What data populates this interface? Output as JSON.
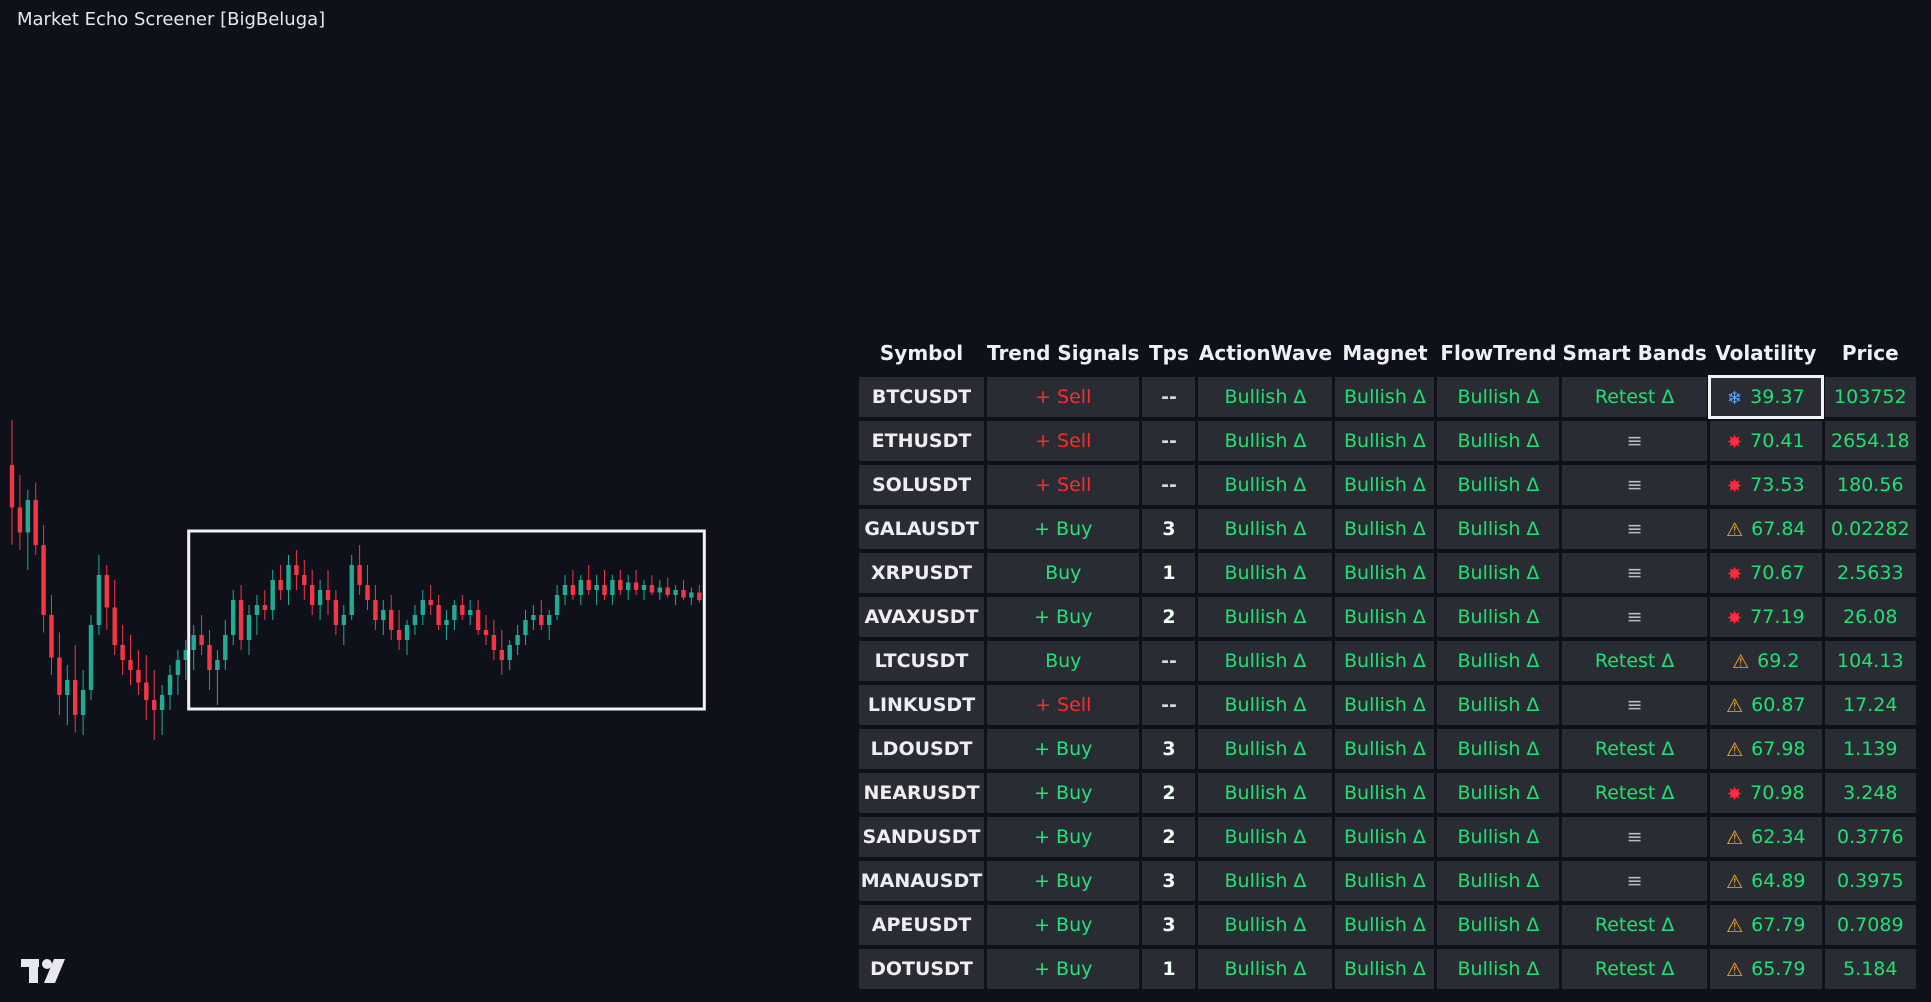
{
  "window": {
    "title": "Market Echo Screener [BigBeluga]"
  },
  "colors": {
    "background": "#0f111a",
    "bull": "#22ab94",
    "bear": "#f23645",
    "sell_cell_bg": "#8b2433",
    "buy_cell_bg": "#2a4a42",
    "tps_cell_bg": "#1f7a57",
    "text_green": "#22e070",
    "text_red": "#ff2a2a",
    "selection_box": "#f2f2f2"
  },
  "table": {
    "headers": [
      "Symbol",
      "Trend Signals",
      "Tps",
      "ActionWave",
      "Magnet",
      "FlowTrend",
      "Smart Bands",
      "Volatility",
      "Price"
    ],
    "rows": [
      {
        "symbol": "BTCUSDT",
        "trend": "+ Sell",
        "trend_type": "sell",
        "tps": "--",
        "action": "Bullish Δ",
        "magnet": "Bullish Δ",
        "flow": "Bullish Δ",
        "smart": "Retest Δ",
        "vol_icon": "snowflake-icon",
        "vol_glyph": "❄",
        "volatility": "39.37",
        "price": "103752",
        "selected": true
      },
      {
        "symbol": "ETHUSDT",
        "trend": "+ Sell",
        "trend_type": "sell",
        "tps": "--",
        "action": "Bullish Δ",
        "magnet": "Bullish Δ",
        "flow": "Bullish Δ",
        "smart": "≡",
        "vol_icon": "burst-icon",
        "vol_glyph": "✸",
        "volatility": "70.41",
        "price": "2654.18"
      },
      {
        "symbol": "SOLUSDT",
        "trend": "+ Sell",
        "trend_type": "sell",
        "tps": "--",
        "action": "Bullish Δ",
        "magnet": "Bullish Δ",
        "flow": "Bullish Δ",
        "smart": "≡",
        "vol_icon": "burst-icon",
        "vol_glyph": "✸",
        "volatility": "73.53",
        "price": "180.56"
      },
      {
        "symbol": "GALAUSDT",
        "trend": "+ Buy",
        "trend_type": "buy",
        "tps": "3",
        "action": "Bullish Δ",
        "magnet": "Bullish Δ",
        "flow": "Bullish Δ",
        "smart": "≡",
        "vol_icon": "warning-icon",
        "vol_glyph": "⚠",
        "volatility": "67.84",
        "price": "0.02282"
      },
      {
        "symbol": "XRPUSDT",
        "trend": "Buy",
        "trend_type": "buy",
        "tps": "1",
        "action": "Bullish Δ",
        "magnet": "Bullish Δ",
        "flow": "Bullish Δ",
        "smart": "≡",
        "vol_icon": "burst-icon",
        "vol_glyph": "✸",
        "volatility": "70.67",
        "price": "2.5633"
      },
      {
        "symbol": "AVAXUSDT",
        "trend": "+ Buy",
        "trend_type": "buy",
        "tps": "2",
        "action": "Bullish Δ",
        "magnet": "Bullish Δ",
        "flow": "Bullish Δ",
        "smart": "≡",
        "vol_icon": "burst-icon",
        "vol_glyph": "✸",
        "volatility": "77.19",
        "price": "26.08"
      },
      {
        "symbol": "LTCUSDT",
        "trend": "Buy",
        "trend_type": "buy-strong",
        "tps": "--",
        "action": "Bullish Δ",
        "magnet": "Bullish Δ",
        "flow": "Bullish Δ",
        "smart": "Retest Δ",
        "vol_icon": "warning-icon",
        "vol_glyph": "⚠",
        "volatility": "69.2",
        "price": "104.13"
      },
      {
        "symbol": "LINKUSDT",
        "trend": "+ Sell",
        "trend_type": "sell",
        "tps": "--",
        "action": "Bullish Δ",
        "magnet": "Bullish Δ",
        "flow": "Bullish Δ",
        "smart": "≡",
        "vol_icon": "warning-icon",
        "vol_glyph": "⚠",
        "volatility": "60.87",
        "price": "17.24"
      },
      {
        "symbol": "LDOUSDT",
        "trend": "+ Buy",
        "trend_type": "buy",
        "tps": "3",
        "action": "Bullish Δ",
        "magnet": "Bullish Δ",
        "flow": "Bullish Δ",
        "smart": "Retest Δ",
        "vol_icon": "warning-icon",
        "vol_glyph": "⚠",
        "volatility": "67.98",
        "price": "1.139"
      },
      {
        "symbol": "NEARUSDT",
        "trend": "+ Buy",
        "trend_type": "buy",
        "tps": "2",
        "action": "Bullish Δ",
        "magnet": "Bullish Δ",
        "flow": "Bullish Δ",
        "smart": "Retest Δ",
        "vol_icon": "burst-icon",
        "vol_glyph": "✸",
        "volatility": "70.98",
        "price": "3.248"
      },
      {
        "symbol": "SANDUSDT",
        "trend": "+ Buy",
        "trend_type": "buy",
        "tps": "2",
        "action": "Bullish Δ",
        "magnet": "Bullish Δ",
        "flow": "Bullish Δ",
        "smart": "≡",
        "vol_icon": "warning-icon",
        "vol_glyph": "⚠",
        "volatility": "62.34",
        "price": "0.3776"
      },
      {
        "symbol": "MANAUSDT",
        "trend": "+ Buy",
        "trend_type": "buy",
        "tps": "3",
        "action": "Bullish Δ",
        "magnet": "Bullish Δ",
        "flow": "Bullish Δ",
        "smart": "≡",
        "vol_icon": "warning-icon",
        "vol_glyph": "⚠",
        "volatility": "64.89",
        "price": "0.3975"
      },
      {
        "symbol": "APEUSDT",
        "trend": "+ Buy",
        "trend_type": "buy",
        "tps": "3",
        "action": "Bullish Δ",
        "magnet": "Bullish Δ",
        "flow": "Bullish Δ",
        "smart": "Retest Δ",
        "vol_icon": "warning-icon",
        "vol_glyph": "⚠",
        "volatility": "67.79",
        "price": "0.7089"
      },
      {
        "symbol": "DOTUSDT",
        "trend": "+ Buy",
        "trend_type": "buy",
        "tps": "1",
        "action": "Bullish Δ",
        "magnet": "Bullish Δ",
        "flow": "Bullish Δ",
        "smart": "Retest Δ",
        "vol_icon": "warning-icon",
        "vol_glyph": "⚠",
        "volatility": "65.79",
        "price": "5.184"
      }
    ]
  },
  "branding": {
    "logo_icon": "tradingview-logo-icon"
  },
  "chart_data": {
    "type": "candlestick",
    "series": [
      {
        "name": "",
        "values": [
          {
            "o": 62,
            "h": 80,
            "l": 30,
            "c": 45
          },
          {
            "o": 45,
            "h": 58,
            "l": 28,
            "c": 35
          },
          {
            "o": 35,
            "h": 52,
            "l": 20,
            "c": 48
          },
          {
            "o": 48,
            "h": 55,
            "l": 26,
            "c": 30
          },
          {
            "o": 30,
            "h": 38,
            "l": -5,
            "c": 2
          },
          {
            "o": 2,
            "h": 10,
            "l": -22,
            "c": -15
          },
          {
            "o": -15,
            "h": -5,
            "l": -38,
            "c": -30
          },
          {
            "o": -30,
            "h": -18,
            "l": -42,
            "c": -24
          },
          {
            "o": -24,
            "h": -10,
            "l": -45,
            "c": -38
          },
          {
            "o": -38,
            "h": -20,
            "l": -46,
            "c": -28
          },
          {
            "o": -28,
            "h": 2,
            "l": -32,
            "c": -2
          },
          {
            "o": -2,
            "h": 26,
            "l": -6,
            "c": 18
          },
          {
            "o": 18,
            "h": 22,
            "l": -4,
            "c": 5
          },
          {
            "o": 5,
            "h": 16,
            "l": -14,
            "c": -10
          },
          {
            "o": -10,
            "h": -2,
            "l": -22,
            "c": -16
          },
          {
            "o": -16,
            "h": -6,
            "l": -26,
            "c": -20
          },
          {
            "o": -20,
            "h": -12,
            "l": -30,
            "c": -25
          },
          {
            "o": -25,
            "h": -14,
            "l": -40,
            "c": -32
          },
          {
            "o": -32,
            "h": -20,
            "l": -48,
            "c": -36
          },
          {
            "o": -36,
            "h": -26,
            "l": -46,
            "c": -30
          },
          {
            "o": -30,
            "h": -18,
            "l": -36,
            "c": -22
          },
          {
            "o": -22,
            "h": -12,
            "l": -30,
            "c": -16
          },
          {
            "o": -16,
            "h": -8,
            "l": -24,
            "c": -12
          },
          {
            "o": -12,
            "h": -2,
            "l": -20,
            "c": -6
          },
          {
            "o": -6,
            "h": 2,
            "l": -14,
            "c": -10
          },
          {
            "o": -10,
            "h": -4,
            "l": -28,
            "c": -20
          },
          {
            "o": -20,
            "h": -12,
            "l": -34,
            "c": -16
          },
          {
            "o": -16,
            "h": 0,
            "l": -20,
            "c": -6
          },
          {
            "o": -6,
            "h": 12,
            "l": -10,
            "c": 8
          },
          {
            "o": 8,
            "h": 14,
            "l": -12,
            "c": -8
          },
          {
            "o": -8,
            "h": 6,
            "l": -14,
            "c": 2
          },
          {
            "o": 2,
            "h": 10,
            "l": -6,
            "c": 6
          },
          {
            "o": 6,
            "h": 12,
            "l": 0,
            "c": 4
          },
          {
            "o": 4,
            "h": 20,
            "l": 0,
            "c": 16
          },
          {
            "o": 16,
            "h": 22,
            "l": 8,
            "c": 12
          },
          {
            "o": 12,
            "h": 26,
            "l": 6,
            "c": 22
          },
          {
            "o": 22,
            "h": 28,
            "l": 12,
            "c": 18
          },
          {
            "o": 18,
            "h": 24,
            "l": 8,
            "c": 14
          },
          {
            "o": 14,
            "h": 20,
            "l": 2,
            "c": 6
          },
          {
            "o": 6,
            "h": 16,
            "l": 0,
            "c": 12
          },
          {
            "o": 12,
            "h": 20,
            "l": 2,
            "c": 8
          },
          {
            "o": 8,
            "h": 12,
            "l": -6,
            "c": -2
          },
          {
            "o": -2,
            "h": 6,
            "l": -10,
            "c": 2
          },
          {
            "o": 2,
            "h": 26,
            "l": 0,
            "c": 22
          },
          {
            "o": 22,
            "h": 30,
            "l": 10,
            "c": 14
          },
          {
            "o": 14,
            "h": 22,
            "l": 4,
            "c": 8
          },
          {
            "o": 8,
            "h": 14,
            "l": -4,
            "c": 0
          },
          {
            "o": 0,
            "h": 8,
            "l": -6,
            "c": 4
          },
          {
            "o": 4,
            "h": 10,
            "l": -8,
            "c": -4
          },
          {
            "o": -4,
            "h": 4,
            "l": -12,
            "c": -8
          },
          {
            "o": -8,
            "h": 0,
            "l": -14,
            "c": -2
          },
          {
            "o": -2,
            "h": 6,
            "l": -6,
            "c": 2
          },
          {
            "o": 2,
            "h": 12,
            "l": -2,
            "c": 8
          },
          {
            "o": 8,
            "h": 14,
            "l": 2,
            "c": 6
          },
          {
            "o": 6,
            "h": 10,
            "l": -4,
            "c": -2
          },
          {
            "o": -2,
            "h": 4,
            "l": -8,
            "c": 0
          },
          {
            "o": 0,
            "h": 8,
            "l": -4,
            "c": 6
          },
          {
            "o": 6,
            "h": 10,
            "l": 0,
            "c": 2
          },
          {
            "o": 2,
            "h": 8,
            "l": -2,
            "c": 4
          },
          {
            "o": 4,
            "h": 8,
            "l": -6,
            "c": -4
          },
          {
            "o": -4,
            "h": 2,
            "l": -10,
            "c": -6
          },
          {
            "o": -6,
            "h": 0,
            "l": -16,
            "c": -12
          },
          {
            "o": -12,
            "h": -4,
            "l": -22,
            "c": -16
          },
          {
            "o": -16,
            "h": -8,
            "l": -20,
            "c": -10
          },
          {
            "o": -10,
            "h": -2,
            "l": -14,
            "c": -6
          },
          {
            "o": -6,
            "h": 4,
            "l": -10,
            "c": 0
          },
          {
            "o": 0,
            "h": 6,
            "l": -4,
            "c": 2
          },
          {
            "o": 2,
            "h": 8,
            "l": -4,
            "c": -2
          },
          {
            "o": -2,
            "h": 4,
            "l": -8,
            "c": 2
          },
          {
            "o": 2,
            "h": 14,
            "l": 0,
            "c": 10
          },
          {
            "o": 10,
            "h": 18,
            "l": 6,
            "c": 14
          },
          {
            "o": 14,
            "h": 20,
            "l": 8,
            "c": 10
          },
          {
            "o": 10,
            "h": 18,
            "l": 6,
            "c": 16
          },
          {
            "o": 16,
            "h": 22,
            "l": 10,
            "c": 12
          },
          {
            "o": 12,
            "h": 18,
            "l": 6,
            "c": 14
          },
          {
            "o": 14,
            "h": 20,
            "l": 8,
            "c": 10
          },
          {
            "o": 10,
            "h": 18,
            "l": 6,
            "c": 16
          },
          {
            "o": 16,
            "h": 20,
            "l": 10,
            "c": 12
          },
          {
            "o": 12,
            "h": 18,
            "l": 8,
            "c": 15
          },
          {
            "o": 15,
            "h": 20,
            "l": 10,
            "c": 12
          },
          {
            "o": 12,
            "h": 16,
            "l": 8,
            "c": 14
          },
          {
            "o": 14,
            "h": 18,
            "l": 10,
            "c": 11
          },
          {
            "o": 11,
            "h": 16,
            "l": 8,
            "c": 13
          },
          {
            "o": 13,
            "h": 17,
            "l": 9,
            "c": 10
          },
          {
            "o": 10,
            "h": 14,
            "l": 6,
            "c": 12
          },
          {
            "o": 12,
            "h": 16,
            "l": 8,
            "c": 9
          },
          {
            "o": 9,
            "h": 13,
            "l": 6,
            "c": 11
          },
          {
            "o": 11,
            "h": 14,
            "l": 7,
            "c": 8
          }
        ]
      }
    ],
    "highlight_range": {
      "start_index": 23,
      "end_index": 87
    },
    "grid": false
  }
}
